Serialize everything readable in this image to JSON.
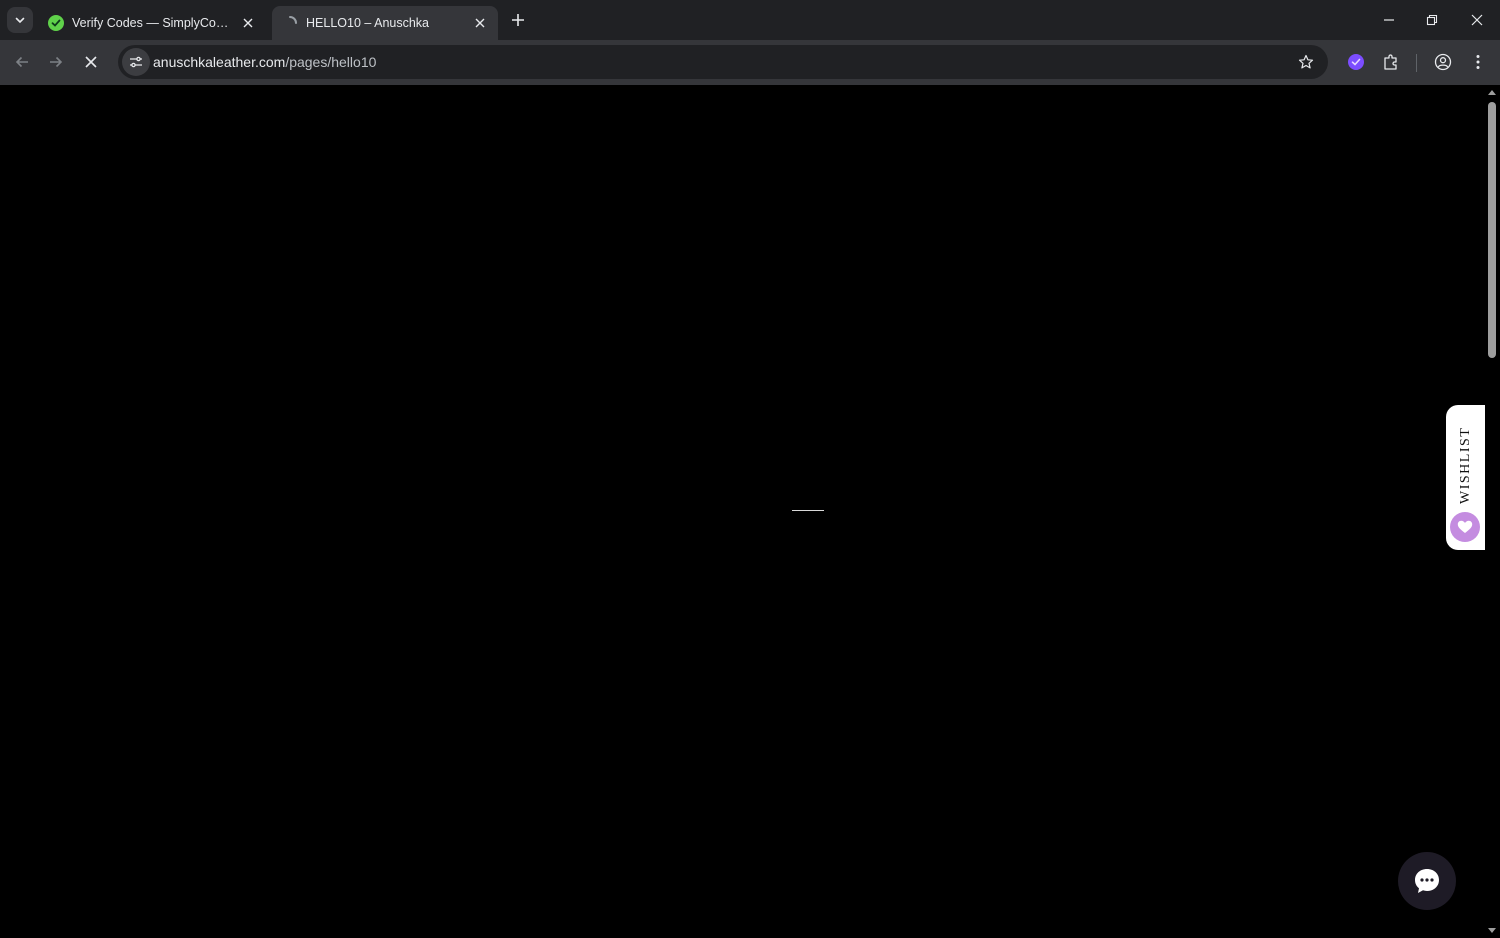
{
  "browser": {
    "tabs": [
      {
        "title": "Verify Codes — SimplyCodes",
        "favicon": "simplycodes-logo-icon",
        "active": false
      },
      {
        "title": "HELLO10 – Anuschka",
        "favicon": "loading-spinner-icon",
        "active": true
      }
    ],
    "url": {
      "host": "anuschkaleather.com",
      "path": "/pages/hello10"
    },
    "accent_color": "#7c4dff"
  },
  "page": {
    "background": "#000000",
    "wishlist": {
      "label": "WISHLIST",
      "heart_color": "#c48ce0"
    }
  }
}
